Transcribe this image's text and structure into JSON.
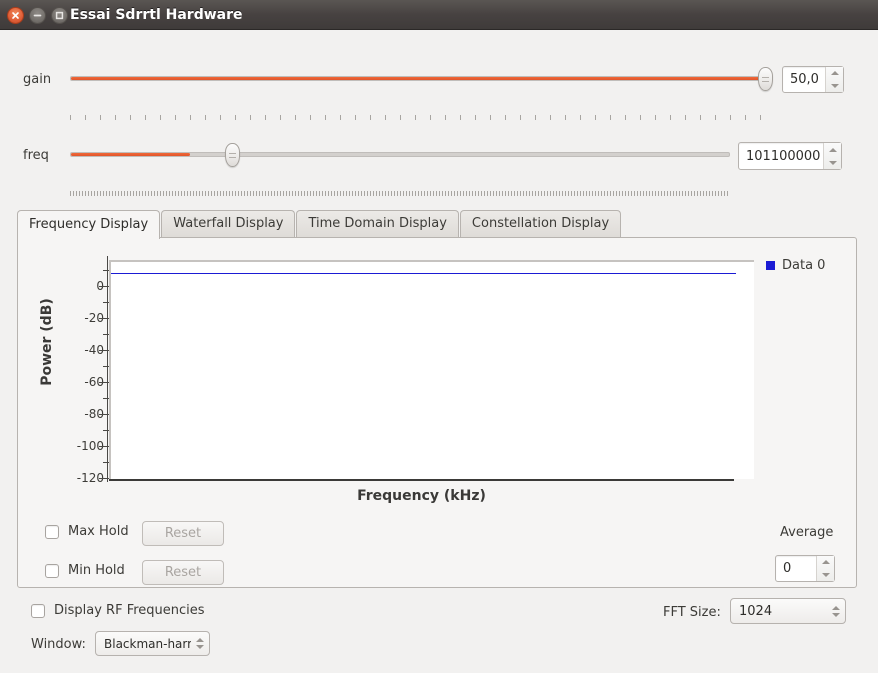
{
  "window": {
    "title": "Essai Sdrrtl Hardware",
    "buttons": {
      "close": "close-button",
      "minimize": "minimize-button",
      "maximize": "maximize-button"
    }
  },
  "controls": {
    "gain": {
      "label": "gain",
      "value": "50,0",
      "slider_percent": 100,
      "tick_spacing": 15
    },
    "freq": {
      "label": "freq",
      "value": "101100000",
      "slider_percent": 18,
      "tick_spacing": 3
    }
  },
  "tabs": [
    {
      "label": "Frequency Display",
      "active": true
    },
    {
      "label": "Waterfall Display",
      "active": false
    },
    {
      "label": "Time Domain Display",
      "active": false
    },
    {
      "label": "Constellation Display",
      "active": false
    }
  ],
  "chart_data": {
    "type": "line",
    "title": "",
    "xlabel": "Frequency (kHz)",
    "ylabel": "Power (dB)",
    "ylim": [
      -120,
      10
    ],
    "yticks": [
      0,
      -20,
      -40,
      -60,
      -80,
      -100,
      -120
    ],
    "ytick_labels": [
      "0",
      "-20",
      "-40",
      "-60",
      "-80",
      "-100",
      "-120"
    ],
    "minor_tick_step": 10,
    "grid": false,
    "legend_position": "right",
    "series": [
      {
        "name": "Data 0",
        "color": "#1b1bd4",
        "constant_value": 0,
        "values": [
          0,
          0,
          0,
          0,
          0,
          0,
          0,
          0,
          0,
          0
        ]
      }
    ],
    "xtick_labels": []
  },
  "hold_controls": {
    "max_hold": {
      "label": "Max Hold",
      "checked": false,
      "reset_label": "Reset",
      "reset_enabled": false
    },
    "min_hold": {
      "label": "Min Hold",
      "checked": false,
      "reset_label": "Reset",
      "reset_enabled": false
    }
  },
  "average": {
    "label": "Average",
    "value": "0"
  },
  "footer": {
    "display_rf": {
      "label": "Display RF Frequencies",
      "checked": false
    },
    "window": {
      "label": "Window:",
      "value": "Blackman-harris"
    },
    "fft_size": {
      "label": "FFT Size:",
      "value": "1024"
    }
  },
  "colors": {
    "accent_orange": "#e2542b",
    "trace_blue": "#1b1bd4",
    "titlebar": "#474241",
    "background": "#f2f1f0"
  }
}
